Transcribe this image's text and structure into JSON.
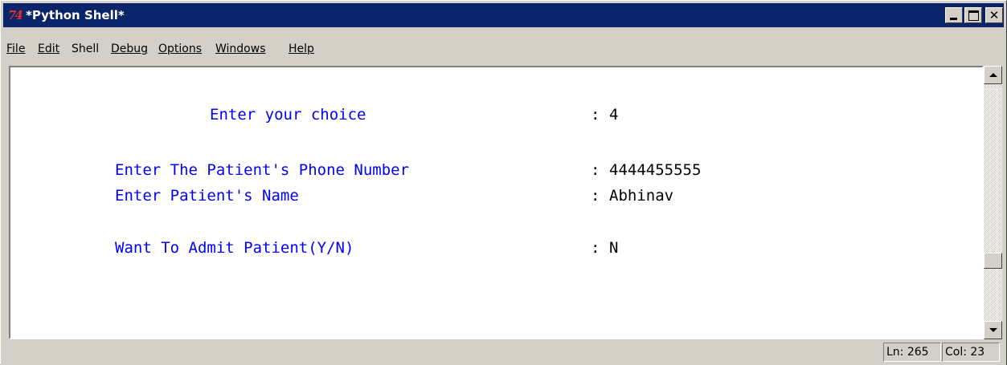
{
  "window": {
    "title": "*Python Shell*",
    "logo_text": "74",
    "controls": {
      "close_glyph": "✕"
    }
  },
  "menubar": {
    "items": [
      {
        "label": "File"
      },
      {
        "label": "Edit"
      },
      {
        "label": "Shell"
      },
      {
        "label": "Debug"
      },
      {
        "label": "Options"
      },
      {
        "label": "Windows"
      },
      {
        "label": "Help"
      }
    ]
  },
  "shell": {
    "lines": [
      {
        "prompt": "Enter your choice",
        "sep": ":",
        "value": "4"
      },
      {
        "prompt": "Enter The Patient's Phone Number",
        "sep": ":",
        "value": "4444455555"
      },
      {
        "prompt": "Enter Patient's Name",
        "sep": ":",
        "value": "Abhinav"
      },
      {
        "prompt": "Want To Admit Patient(Y/N)",
        "sep": ":",
        "value": "N"
      }
    ]
  },
  "status": {
    "ln": "Ln: 265",
    "col": "Col: 23"
  },
  "colors": {
    "titlebar": "#0a246a",
    "prompt_text": "#0000ff",
    "input_text": "#000000",
    "window_bg": "#d4d0c8"
  }
}
